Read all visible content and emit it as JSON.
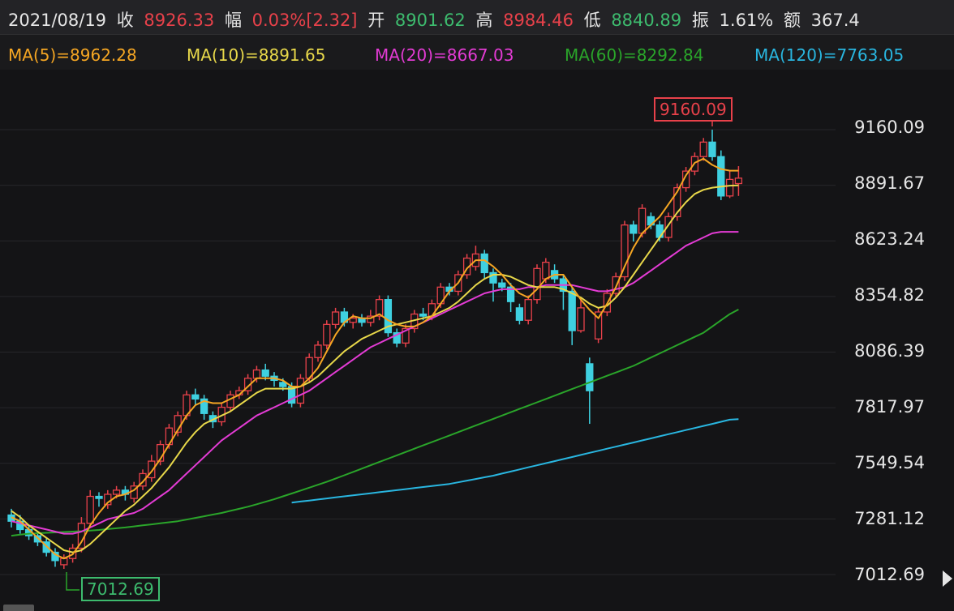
{
  "header": {
    "date": "2021/08/19",
    "close_label": "收",
    "close": "8926.33",
    "change_label": "幅",
    "change": "0.03%[2.32]",
    "open_label": "开",
    "open": "8901.62",
    "high_label": "高",
    "high": "8984.46",
    "low_label": "低",
    "low": "8840.89",
    "amplitude_label": "振",
    "amplitude": "1.61%",
    "amount_label": "额",
    "amount": "367.4"
  },
  "ma": {
    "ma5": "MA(5)=8962.28",
    "ma10": "MA(10)=8891.65",
    "ma20": "MA(20)=8667.03",
    "ma60": "MA(60)=8292.84",
    "ma120": "MA(120)=7763.05"
  },
  "colors": {
    "up": "#e8414a",
    "down": "#3fd0e0",
    "ma5": "#f5a623",
    "ma10": "#e8d84a",
    "ma20": "#e33bd4",
    "ma60": "#2aa52a",
    "ma120": "#29b6e0"
  },
  "axis": {
    "ticks": [
      "9160.09",
      "8891.67",
      "8623.24",
      "8354.82",
      "8086.39",
      "7817.97",
      "7549.54",
      "7281.12",
      "7012.69"
    ]
  },
  "annotations": {
    "high_marker": "9160.09",
    "low_marker": "7012.69"
  },
  "chart_data": {
    "type": "candlestick",
    "ylim": [
      7012.69,
      9160.09
    ],
    "candles": [
      [
        7300,
        7270,
        7330,
        7240
      ],
      [
        7270,
        7230,
        7300,
        7210
      ],
      [
        7230,
        7200,
        7250,
        7180
      ],
      [
        7200,
        7170,
        7220,
        7150
      ],
      [
        7170,
        7120,
        7190,
        7100
      ],
      [
        7120,
        7080,
        7140,
        7050
      ],
      [
        7060,
        7090,
        7110,
        7040
      ],
      [
        7090,
        7140,
        7160,
        7070
      ],
      [
        7140,
        7260,
        7290,
        7120
      ],
      [
        7260,
        7390,
        7420,
        7240
      ],
      [
        7390,
        7380,
        7410,
        7340
      ],
      [
        7350,
        7400,
        7420,
        7330
      ],
      [
        7400,
        7420,
        7440,
        7380
      ],
      [
        7420,
        7400,
        7440,
        7370
      ],
      [
        7380,
        7440,
        7460,
        7360
      ],
      [
        7440,
        7500,
        7520,
        7420
      ],
      [
        7480,
        7560,
        7590,
        7460
      ],
      [
        7560,
        7640,
        7660,
        7540
      ],
      [
        7640,
        7720,
        7740,
        7620
      ],
      [
        7700,
        7780,
        7800,
        7680
      ],
      [
        7780,
        7880,
        7900,
        7760
      ],
      [
        7880,
        7860,
        7910,
        7830
      ],
      [
        7860,
        7790,
        7880,
        7760
      ],
      [
        7780,
        7750,
        7800,
        7720
      ],
      [
        7750,
        7820,
        7840,
        7730
      ],
      [
        7820,
        7880,
        7900,
        7800
      ],
      [
        7880,
        7900,
        7920,
        7860
      ],
      [
        7900,
        7960,
        7980,
        7880
      ],
      [
        7960,
        8000,
        8020,
        7940
      ],
      [
        8000,
        7970,
        8030,
        7950
      ],
      [
        7970,
        7950,
        7990,
        7920
      ],
      [
        7940,
        7920,
        7960,
        7900
      ],
      [
        7920,
        7840,
        7940,
        7820
      ],
      [
        7840,
        7960,
        7980,
        7820
      ],
      [
        7960,
        8060,
        8080,
        7940
      ],
      [
        8060,
        8120,
        8140,
        8040
      ],
      [
        8120,
        8220,
        8240,
        8100
      ],
      [
        8220,
        8280,
        8300,
        8200
      ],
      [
        8280,
        8230,
        8300,
        8210
      ],
      [
        8230,
        8250,
        8270,
        8200
      ],
      [
        8250,
        8230,
        8270,
        8210
      ],
      [
        8230,
        8260,
        8290,
        8210
      ],
      [
        8260,
        8340,
        8360,
        8240
      ],
      [
        8340,
        8180,
        8360,
        8160
      ],
      [
        8180,
        8130,
        8200,
        8110
      ],
      [
        8130,
        8200,
        8220,
        8110
      ],
      [
        8200,
        8270,
        8290,
        8180
      ],
      [
        8270,
        8260,
        8300,
        8240
      ],
      [
        8260,
        8320,
        8340,
        8240
      ],
      [
        8320,
        8400,
        8420,
        8300
      ],
      [
        8400,
        8380,
        8420,
        8360
      ],
      [
        8380,
        8460,
        8480,
        8360
      ],
      [
        8460,
        8540,
        8560,
        8440
      ],
      [
        8500,
        8560,
        8600,
        8480
      ],
      [
        8560,
        8470,
        8580,
        8440
      ],
      [
        8470,
        8420,
        8490,
        8330
      ],
      [
        8420,
        8400,
        8440,
        8380
      ],
      [
        8400,
        8330,
        8420,
        8280
      ],
      [
        8300,
        8240,
        8320,
        8220
      ],
      [
        8240,
        8340,
        8360,
        8220
      ],
      [
        8340,
        8490,
        8510,
        8320
      ],
      [
        8440,
        8520,
        8540,
        8420
      ],
      [
        8480,
        8440,
        8510,
        8420
      ],
      [
        8440,
        8380,
        8460,
        8290
      ],
      [
        8380,
        8190,
        8400,
        8120
      ],
      [
        8190,
        8300,
        8350,
        8180
      ],
      [
        8030,
        7900,
        8060,
        7740
      ],
      [
        8150,
        8280,
        8300,
        8130
      ],
      [
        8280,
        8370,
        8390,
        8260
      ],
      [
        8370,
        8450,
        8470,
        8350
      ],
      [
        8450,
        8700,
        8720,
        8430
      ],
      [
        8700,
        8660,
        8720,
        8620
      ],
      [
        8660,
        8780,
        8800,
        8640
      ],
      [
        8740,
        8700,
        8760,
        8680
      ],
      [
        8700,
        8640,
        8720,
        8620
      ],
      [
        8640,
        8740,
        8760,
        8620
      ],
      [
        8740,
        8880,
        8900,
        8720
      ],
      [
        8880,
        8960,
        8980,
        8860
      ],
      [
        8960,
        9030,
        9050,
        8940
      ],
      [
        9030,
        9100,
        9120,
        9010
      ],
      [
        9100,
        9030,
        9160,
        9010
      ],
      [
        9030,
        8840,
        9060,
        8820
      ],
      [
        8840,
        8920,
        8960,
        8830
      ],
      [
        8900,
        8926,
        8984,
        8840
      ]
    ],
    "ma5": [
      7290,
      7270,
      7230,
      7190,
      7150,
      7110,
      7090,
      7110,
      7170,
      7250,
      7310,
      7360,
      7390,
      7400,
      7420,
      7460,
      7510,
      7570,
      7640,
      7710,
      7780,
      7830,
      7850,
      7840,
      7840,
      7860,
      7880,
      7920,
      7960,
      7960,
      7960,
      7950,
      7920,
      7920,
      7960,
      8010,
      8090,
      8170,
      8230,
      8260,
      8250,
      8250,
      8270,
      8240,
      8220,
      8210,
      8210,
      8230,
      8260,
      8320,
      8380,
      8420,
      8490,
      8530,
      8530,
      8500,
      8460,
      8410,
      8370,
      8350,
      8390,
      8440,
      8460,
      8460,
      8400,
      8340,
      8290,
      8250,
      8320,
      8400,
      8500,
      8590,
      8660,
      8700,
      8740,
      8800,
      8860,
      8940,
      9000,
      9020,
      8990,
      8970,
      8962,
      8962
    ],
    "ma10": [
      7320,
      7290,
      7250,
      7220,
      7190,
      7160,
      7130,
      7120,
      7130,
      7160,
      7200,
      7240,
      7280,
      7320,
      7350,
      7390,
      7430,
      7480,
      7530,
      7590,
      7650,
      7700,
      7740,
      7760,
      7780,
      7800,
      7830,
      7860,
      7890,
      7910,
      7910,
      7910,
      7910,
      7920,
      7940,
      7970,
      8010,
      8050,
      8090,
      8120,
      8150,
      8170,
      8190,
      8210,
      8220,
      8230,
      8240,
      8250,
      8260,
      8280,
      8300,
      8330,
      8370,
      8410,
      8440,
      8460,
      8460,
      8450,
      8430,
      8410,
      8400,
      8400,
      8400,
      8390,
      8370,
      8350,
      8320,
      8300,
      8310,
      8350,
      8400,
      8460,
      8520,
      8580,
      8640,
      8700,
      8760,
      8810,
      8850,
      8870,
      8880,
      8885,
      8890,
      8891
    ],
    "ma20": [
      7270,
      7260,
      7250,
      7240,
      7230,
      7220,
      7210,
      7210,
      7220,
      7240,
      7260,
      7280,
      7290,
      7300,
      7310,
      7330,
      7360,
      7390,
      7420,
      7460,
      7500,
      7540,
      7580,
      7620,
      7660,
      7690,
      7720,
      7750,
      7780,
      7800,
      7820,
      7840,
      7860,
      7880,
      7900,
      7930,
      7960,
      7990,
      8020,
      8050,
      8080,
      8110,
      8130,
      8150,
      8170,
      8190,
      8210,
      8230,
      8250,
      8270,
      8290,
      8310,
      8330,
      8350,
      8370,
      8380,
      8390,
      8390,
      8390,
      8400,
      8400,
      8410,
      8410,
      8410,
      8410,
      8400,
      8390,
      8380,
      8380,
      8390,
      8400,
      8420,
      8450,
      8480,
      8510,
      8540,
      8570,
      8600,
      8620,
      8640,
      8660,
      8667,
      8667,
      8667
    ],
    "ma60": [
      7200,
      7205,
      7210,
      7212,
      7214,
      7216,
      7218,
      7220,
      7222,
      7225,
      7228,
      7232,
      7236,
      7240,
      7245,
      7250,
      7255,
      7260,
      7265,
      7270,
      7278,
      7286,
      7294,
      7302,
      7310,
      7320,
      7330,
      7340,
      7352,
      7364,
      7376,
      7390,
      7404,
      7418,
      7432,
      7446,
      7460,
      7476,
      7492,
      7508,
      7524,
      7540,
      7556,
      7572,
      7588,
      7604,
      7620,
      7636,
      7652,
      7668,
      7684,
      7700,
      7716,
      7732,
      7748,
      7764,
      7780,
      7796,
      7812,
      7828,
      7844,
      7860,
      7876,
      7892,
      7908,
      7924,
      7940,
      7956,
      7972,
      7988,
      8004,
      8020,
      8040,
      8060,
      8080,
      8100,
      8120,
      8140,
      8160,
      8180,
      8210,
      8240,
      8270,
      8292
    ],
    "ma120": [
      7360,
      7365,
      7370,
      7375,
      7380,
      7385,
      7390,
      7395,
      7400,
      7405,
      7410,
      7415,
      7420,
      7425,
      7430,
      7435,
      7440,
      7445,
      7450,
      7458,
      7466,
      7474,
      7482,
      7490,
      7500,
      7510,
      7520,
      7530,
      7540,
      7550,
      7560,
      7570,
      7580,
      7590,
      7600,
      7610,
      7620,
      7630,
      7640,
      7650,
      7660,
      7670,
      7680,
      7690,
      7700,
      7710,
      7720,
      7730,
      7740,
      7750,
      7760,
      7763
    ],
    "ma120_start_index": 32
  }
}
